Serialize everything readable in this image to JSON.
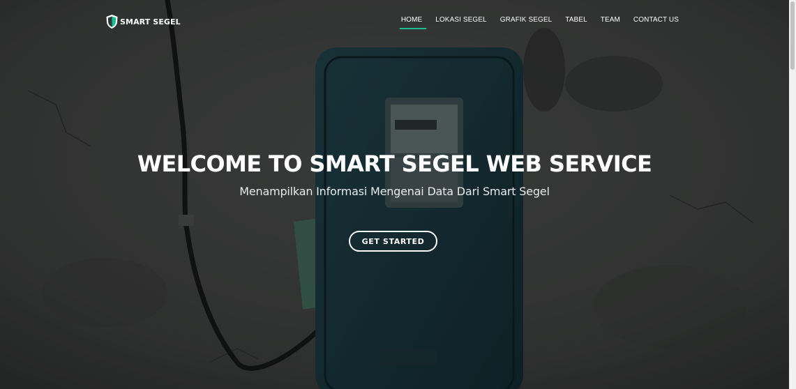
{
  "brand": {
    "name": "SMART SEGEL",
    "icon": "shield-icon",
    "accent_color": "#1bbd95"
  },
  "nav": {
    "items": [
      {
        "label": "HOME",
        "active": true
      },
      {
        "label": "LOKASI SEGEL",
        "active": false
      },
      {
        "label": "GRAFIK SEGEL",
        "active": false
      },
      {
        "label": "TABEL",
        "active": false
      },
      {
        "label": "TEAM",
        "active": false
      },
      {
        "label": "CONTACT US",
        "active": false
      }
    ]
  },
  "hero": {
    "title": "WELCOME TO SMART SEGEL WEB SERVICE",
    "subtitle": "Menampilkan Informasi Mengenai Data Dari Smart Segel",
    "cta_label": "GET STARTED",
    "background_subject": "electricity meter on wall"
  }
}
